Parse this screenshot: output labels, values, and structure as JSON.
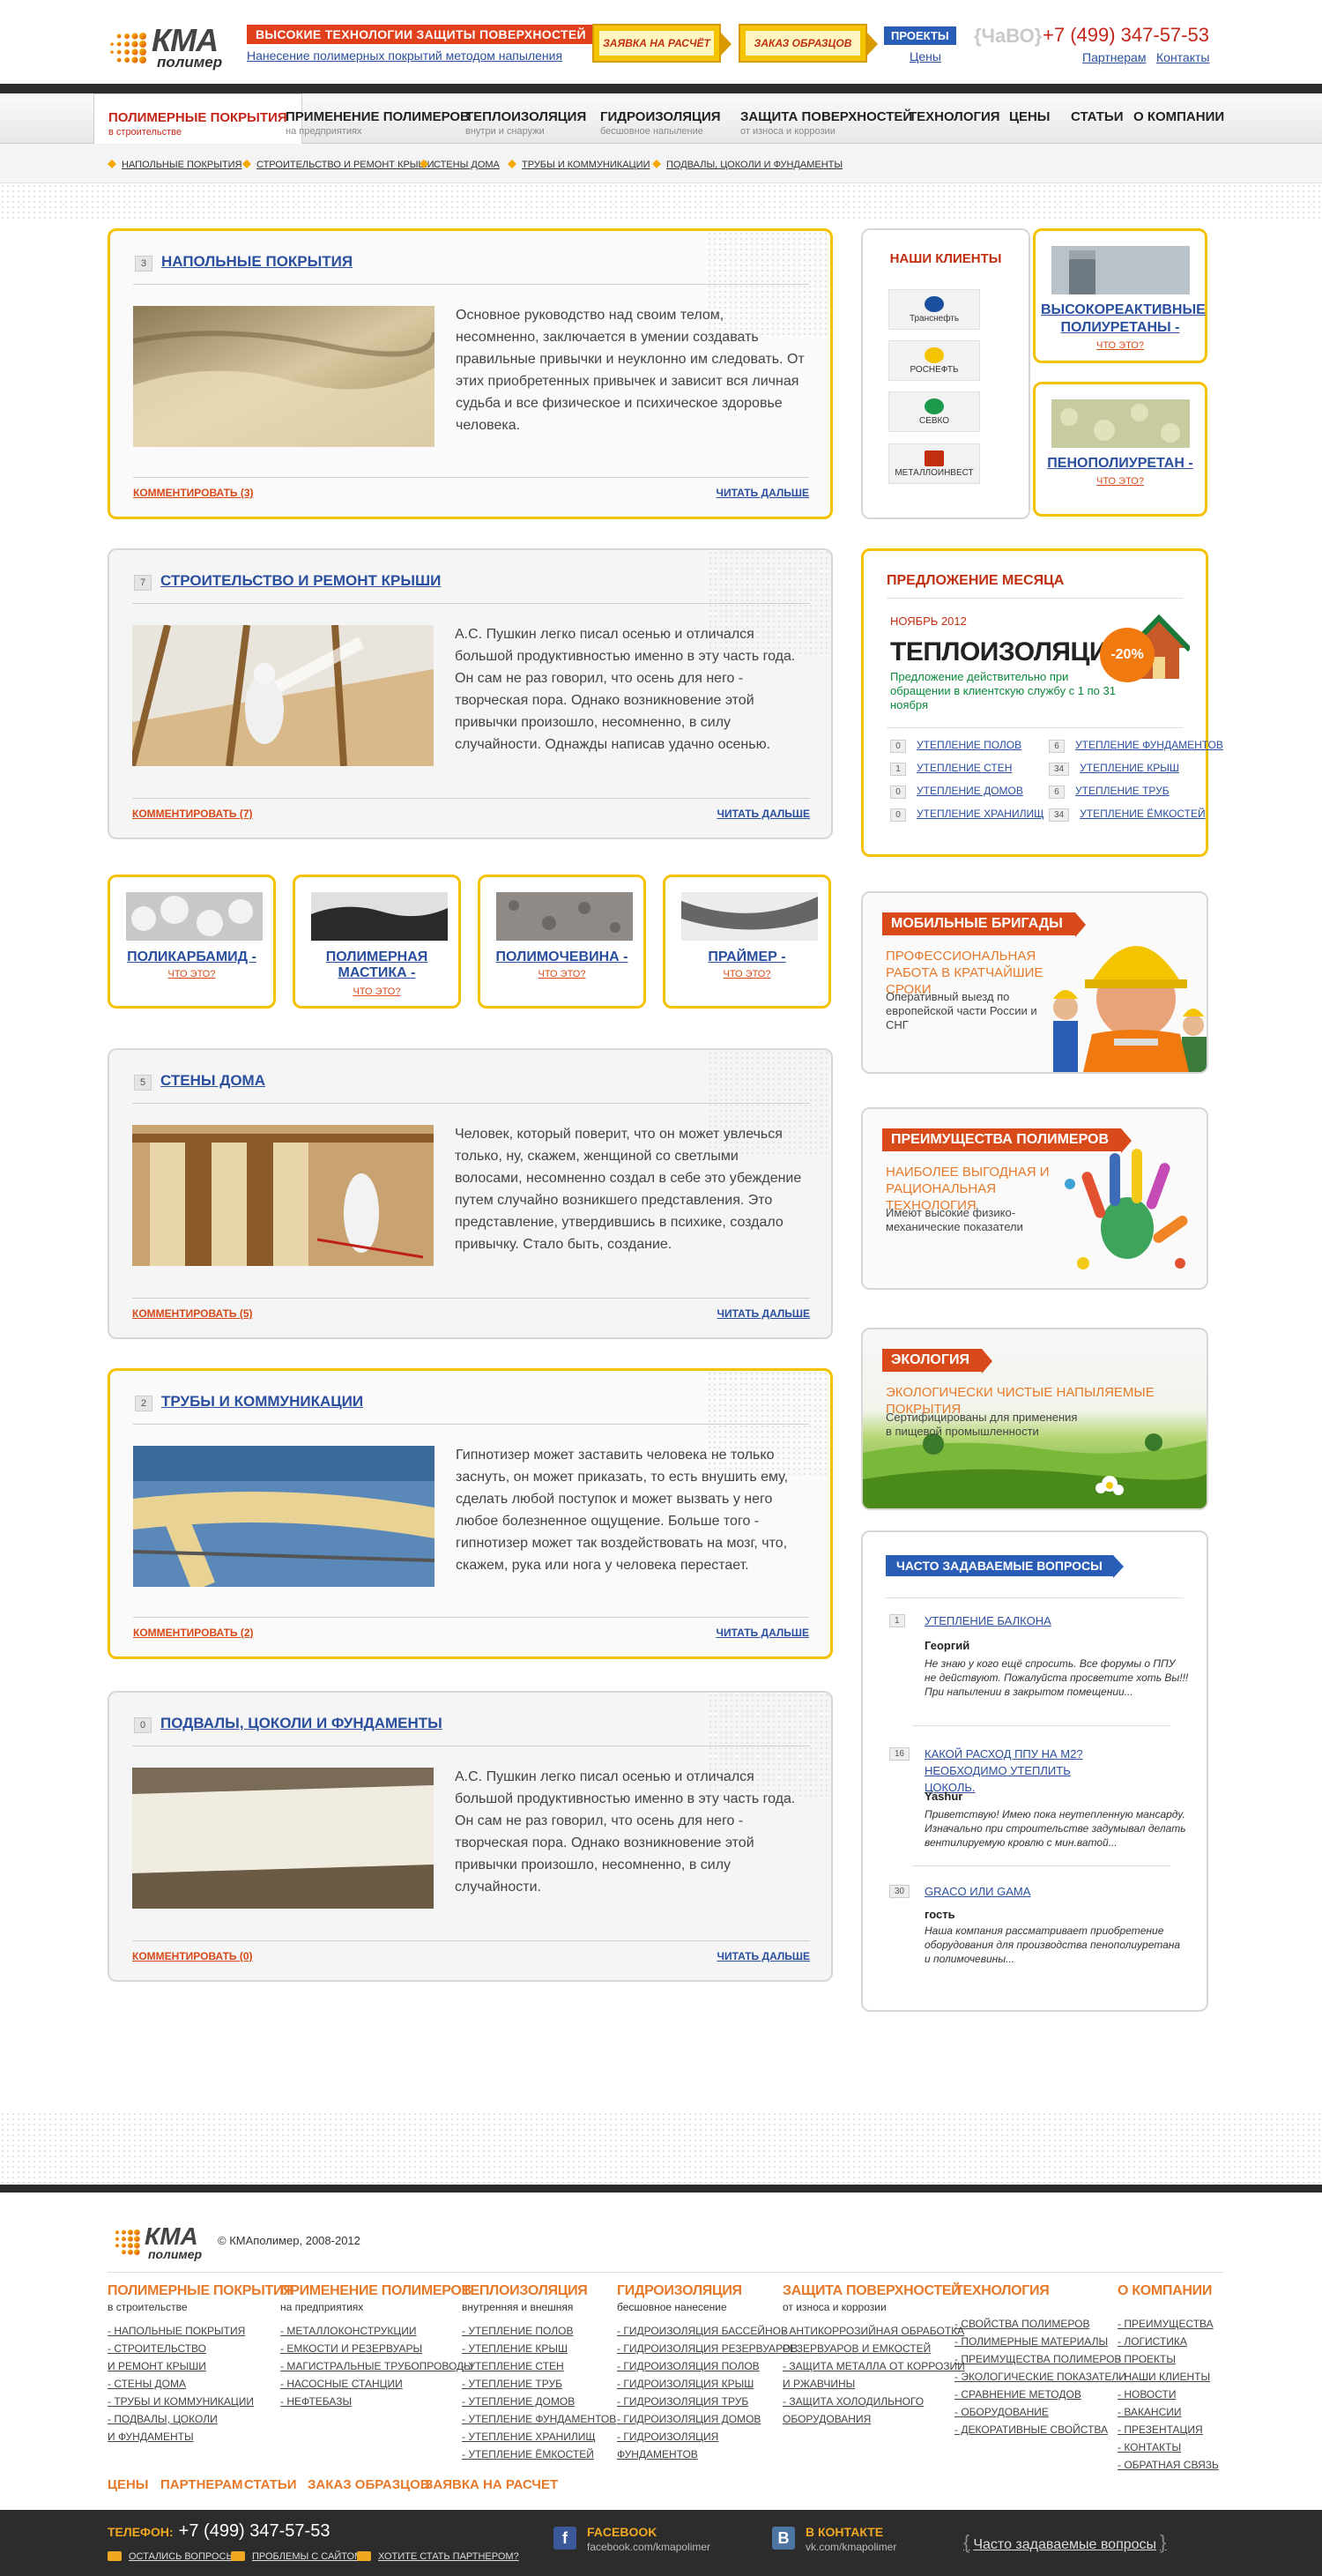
{
  "colors": {
    "accent": "#f4c200",
    "brand_red": "#c5261a",
    "link": "#2a4f9e",
    "orange": "#e77a2a",
    "dark": "#2c2c2c"
  },
  "header": {
    "logo_text": "КМА",
    "logo_sub": "полимер",
    "slogan": "ВЫСОКИЕ ТЕХНОЛОГИИ ЗАЩИТЫ ПОВЕРХНОСТЕЙ",
    "sublink": "Нанесение полимерных покрытий методом напыления",
    "btn_request": "ЗАЯВКА НА РАСЧЁТ",
    "btn_samples": "ЗАКАЗ ОБРАЗЦОВ",
    "projects": "ПРОЕКТЫ",
    "prices": "Цены",
    "faq": "{ЧаВО}",
    "phone": "+7 (499) 347-57-53",
    "partners": "Партнерам",
    "contacts": "Контакты"
  },
  "nav": [
    {
      "title": "ПОЛИМЕРНЫЕ ПОКРЫТИЯ",
      "sub": "в строительстве"
    },
    {
      "title": "ПРИМЕНЕНИЕ ПОЛИМЕРОВ",
      "sub": "на предприятиях"
    },
    {
      "title": "ТЕПЛОИЗОЛЯЦИЯ",
      "sub": "внутри и снаружи"
    },
    {
      "title": "ГИДРОИЗОЛЯЦИЯ",
      "sub": "бесшовное напыление"
    },
    {
      "title": "ЗАЩИТА ПОВЕРХНОСТЕЙ",
      "sub": "от износа и коррозии"
    },
    {
      "title": "ТЕХНОЛОГИЯ",
      "sub": ""
    },
    {
      "title": "ЦЕНЫ",
      "sub": ""
    },
    {
      "title": "СТАТЬИ",
      "sub": ""
    },
    {
      "title": "О КОМПАНИИ",
      "sub": ""
    }
  ],
  "subnav": [
    "НАПОЛЬНЫЕ ПОКРЫТИЯ",
    "СТРОИТЕЛЬСТВО И РЕМОНТ КРЫШИ",
    "СТЕНЫ ДОМА",
    "ТРУБЫ И КОММУНИКАЦИИ",
    "ПОДВАЛЫ, ЦОКОЛИ И ФУНДАМЕНТЫ"
  ],
  "posts": [
    {
      "num": "3",
      "title": "НАПОЛЬНЫЕ ПОКРЫТИЯ",
      "text": "Основное руководство над своим телом, несомненно, заключается в умении создавать правильные привычки и неуклонно им следовать. От этих приобретенных привычек и зависит вся личная судьба и все физическое и психическое здоровье человека.",
      "comments": "КОММЕНТИРОВАТЬ (3)",
      "more": "ЧИТАТЬ ДАЛЬШЕ"
    },
    {
      "num": "7",
      "title": "СТРОИТЕЛЬСТВО И РЕМОНТ КРЫШИ",
      "text": "А.С. Пушкин легко писал осенью и отличался большой продуктивностью именно в эту часть года. Он сам не раз говорил, что осень для него - творческая пора. Однако возникновение этой привычки произошло, несомненно, в силу случайности. Однажды написав удачно осенью.",
      "comments": "КОММЕНТИРОВАТЬ (7)",
      "more": "ЧИТАТЬ ДАЛЬШЕ"
    },
    {
      "num": "5",
      "title": "СТЕНЫ ДОМА",
      "text": "Человек, который поверит, что он может увлечься только, ну, скажем, женщиной со светлыми волосами, несомненно создал в себе это убеждение путем случайно возникшего представления. Это представление, утвердившись в психике, создало привычку. Стало быть, создание.",
      "comments": "КОММЕНТИРОВАТЬ (5)",
      "more": "ЧИТАТЬ ДАЛЬШЕ"
    },
    {
      "num": "2",
      "title": "ТРУБЫ И КОММУНИКАЦИИ",
      "text": "Гипнотизер может заставить человека не только заснуть, он может приказать, то есть внушить ему, сделать любой поступок и может вызвать у него любое болезненное ощущение. Больше того - гипнотизер может так воздействовать на мозг, что, скажем, рука или нога у человека перестает.",
      "comments": "КОММЕНТИРОВАТЬ (2)",
      "more": "ЧИТАТЬ ДАЛЬШЕ"
    },
    {
      "num": "0",
      "title": "ПОДВАЛЫ, ЦОКОЛИ И ФУНДАМЕНТЫ",
      "text": "А.С. Пушкин легко писал осенью и отличался большой продуктивностью именно в эту часть года. Он сам не раз говорил, что осень для него - творческая пора. Однако возникновение этой привычки произошло, несомненно, в силу случайности.",
      "comments": "КОММЕНТИРОВАТЬ (0)",
      "more": "ЧИТАТЬ ДАЛЬШЕ"
    }
  ],
  "materials": [
    {
      "title": "ПОЛИКАРБАМИД -",
      "q": "ЧТО ЭТО?"
    },
    {
      "title": "ПОЛИМЕРНАЯ МАСТИКА -",
      "q": "ЧТО ЭТО?"
    },
    {
      "title": "ПОЛИМОЧЕВИНА -",
      "q": "ЧТО ЭТО?"
    },
    {
      "title": "ПРАЙМЕР -",
      "q": "ЧТО ЭТО?"
    }
  ],
  "clients": {
    "title": "НАШИ КЛИЕНТЫ",
    "items": [
      "Транснефть",
      "РОСНЕФТЬ",
      "СЕВКО",
      "МЕТАЛЛОИНВЕСТ"
    ]
  },
  "products": [
    {
      "title": "ВЫСОКОРЕАКТИВНЫЕ ПОЛИУРЕТАНЫ -",
      "q": "ЧТО ЭТО?"
    },
    {
      "title": "ПЕНОПОЛИУРЕТАН -",
      "q": "ЧТО ЭТО?"
    }
  ],
  "offer": {
    "title": "ПРЕДЛОЖЕНИЕ МЕСЯЦА",
    "month": "НОЯБРЬ 2012",
    "heading": "ТЕПЛОИЗОЛЯЦИЯ",
    "desc": "Предложение действительно при обращении в клиентскую службу с 1 по 31 ноября",
    "discount": "-20%",
    "links": [
      {
        "n": "0",
        "t": "УТЕПЛЕНИЕ ПОЛОВ"
      },
      {
        "n": "6",
        "t": "УТЕПЛЕНИЕ ФУНДАМЕНТОВ"
      },
      {
        "n": "1",
        "t": "УТЕПЛЕНИЕ СТЕН"
      },
      {
        "n": "34",
        "t": "УТЕПЛЕНИЕ КРЫШ"
      },
      {
        "n": "0",
        "t": "УТЕПЛЕНИЕ ДОМОВ"
      },
      {
        "n": "6",
        "t": "УТЕПЛЕНИЕ ТРУБ"
      },
      {
        "n": "0",
        "t": "УТЕПЛЕНИЕ ХРАНИЛИЩ"
      },
      {
        "n": "34",
        "t": "УТЕПЛЕНИЕ ЁМКОСТЕЙ"
      }
    ]
  },
  "promos": [
    {
      "label": "МОБИЛЬНЫЕ БРИГАДЫ",
      "sub": "ПРОФЕССИОНАЛЬНАЯ РАБОТА В КРАТЧАЙШИЕ СРОКИ",
      "desc": "Оперативный выезд по европейской части России и СНГ"
    },
    {
      "label": "ПРЕИМУЩЕСТВА ПОЛИМЕРОВ",
      "sub": "НАИБОЛЕЕ ВЫГОДНАЯ И РАЦИОНАЛЬНАЯ ТЕХНОЛОГИЯ",
      "desc": "Имеют высокие физико-механические показатели"
    },
    {
      "label": "ЭКОЛОГИЯ",
      "sub": "ЭКОЛОГИЧЕСКИ ЧИСТЫЕ НАПЫЛЯЕМЫЕ ПОКРЫТИЯ",
      "desc": "Сертифицированы для применения в пищевой промышленности"
    }
  ],
  "faq": {
    "title": "ЧАСТО ЗАДАВАЕМЫЕ ВОПРОСЫ",
    "items": [
      {
        "n": "1",
        "q": "УТЕПЛЕНИЕ БАЛКОНА",
        "author": "Георгий",
        "text": "Не знаю у кого ещё спросить. Все форумы о ППУ не действуют. Пожалуйста просветите хоть Вы!!! При напылении в закрытом помещении..."
      },
      {
        "n": "16",
        "q": "КАКОЙ РАСХОД ППУ НА М2? НЕОБХОДИМО УТЕПЛИТЬ ЦОКОЛЬ.",
        "author": "Yashur",
        "text": "Приветствую! Имею пока неутепленную мансарду. Изначально при строительстве задумывал делать вентилируемую кровлю с мин.ватой..."
      },
      {
        "n": "30",
        "q": "GRACO ИЛИ GAMA",
        "author": "гость",
        "text": "Наша компания рассматривает приобретение оборудования для производства пенополиуретана и полимочевины..."
      }
    ]
  },
  "footer": {
    "copyright": "© КМАполимер, 2008-2012",
    "cols": [
      {
        "title": "ПОЛИМЕРНЫЕ ПОКРЫТИЯ",
        "sub": "в строительстве",
        "items": [
          "- НАПОЛЬНЫЕ ПОКРЫТИЯ",
          "- СТРОИТЕЛЬСТВО",
          "И РЕМОНТ КРЫШИ",
          "- СТЕНЫ ДОМА",
          "- ТРУБЫ И КОММУНИКАЦИИ",
          "- ПОДВАЛЫ, ЦОКОЛИ",
          "И ФУНДАМЕНТЫ"
        ]
      },
      {
        "title": "ПРИМЕНЕНИЕ ПОЛИМЕРОВ",
        "sub": "на предприятиях",
        "items": [
          "- МЕТАЛЛОКОНСТРУКЦИИ",
          "- ЕМКОСТИ И РЕЗЕРВУАРЫ",
          "- МАГИСТРАЛЬНЫЕ ТРУБОПРОВОДЫ",
          "- НАСОСНЫЕ СТАНЦИИ",
          "- НЕФТЕБАЗЫ"
        ]
      },
      {
        "title": "ТЕПЛОИЗОЛЯЦИЯ",
        "sub": "внутренняя и внешняя",
        "items": [
          "- УТЕПЛЕНИЕ ПОЛОВ",
          "- УТЕПЛЕНИЕ КРЫШ",
          "- УТЕПЛЕНИЕ СТЕН",
          "- УТЕПЛЕНИЕ ТРУБ",
          "- УТЕПЛЕНИЕ ДОМОВ",
          "- УТЕПЛЕНИЕ ФУНДАМЕНТОВ",
          "- УТЕПЛЕНИЕ ХРАНИЛИЩ",
          "- УТЕПЛЕНИЕ ЁМКОСТЕЙ"
        ]
      },
      {
        "title": "ГИДРОИЗОЛЯЦИЯ",
        "sub": "бесшовное нанесение",
        "items": [
          "- ГИДРОИЗОЛЯЦИЯ БАССЕЙНОВ",
          "- ГИДРОИЗОЛЯЦИЯ РЕЗЕРВУАРОВ",
          "- ГИДРОИЗОЛЯЦИЯ ПОЛОВ",
          "- ГИДРОИЗОЛЯЦИЯ КРЫШ",
          "- ГИДРОИЗОЛЯЦИЯ ТРУБ",
          "- ГИДРОИЗОЛЯЦИЯ ДОМОВ",
          "- ГИДРОИЗОЛЯЦИЯ",
          "ФУНДАМЕНТОВ"
        ]
      },
      {
        "title": "ЗАЩИТА ПОВЕРХНОСТЕЙ",
        "sub": "от износа и коррозии",
        "items": [
          "- АНТИКОРРОЗИЙНАЯ ОБРАБОТКА",
          "РЕЗЕРВУАРОВ И ЕМКОСТЕЙ",
          "- ЗАЩИТА МЕТАЛЛА ОТ КОРРОЗИИ",
          "И РЖАВЧИНЫ",
          "- ЗАЩИТА ХОЛОДИЛЬНОГО",
          "ОБОРУДОВАНИЯ"
        ]
      },
      {
        "title": "ТЕХНОЛОГИЯ",
        "sub": "",
        "items": [
          "- СВОЙСТВА ПОЛИМЕРОВ",
          "- ПОЛИМЕРНЫЕ МАТЕРИАЛЫ",
          "- ПРЕИМУЩЕСТВА ПОЛИМЕРОВ",
          "- ЭКОЛОГИЧЕСКИЕ ПОКАЗАТЕЛИ",
          "- СРАВНЕНИЕ МЕТОДОВ",
          "- ОБОРУДОВАНИЕ",
          "- ДЕКОРАТИВНЫЕ СВОЙСТВА"
        ]
      },
      {
        "title": "О КОМПАНИИ",
        "sub": "",
        "items": [
          "- ПРЕИМУЩЕСТВА",
          "- ЛОГИСТИКА",
          "- ПРОЕКТЫ",
          "- НАШИ КЛИЕНТЫ",
          "- НОВОСТИ",
          "- ВАКАНСИИ",
          "- ПРЕЗЕНТАЦИЯ",
          "- КОНТАКТЫ",
          "- ОБРАТНАЯ СВЯЗЬ"
        ]
      }
    ],
    "bottom_links": [
      "ЦЕНЫ",
      "ПАРТНЕРАМ",
      "СТАТЬИ",
      "ЗАКАЗ ОБРАЗЦОВ",
      "ЗАЯВКА НА РАСЧЕТ"
    ]
  },
  "darkbar": {
    "phone_label": "ТЕЛЕФОН:",
    "phone": "+7 (499) 347-57-53",
    "links": [
      "ОСТАЛИСЬ ВОПРОСЫ?",
      "ПРОБЛЕМЫ С САЙТОМ?",
      "ХОТИТЕ СТАТЬ ПАРТНЕРОМ?"
    ],
    "facebook": {
      "name": "FACEBOOK",
      "url": "facebook.com/kmapolimer"
    },
    "vk": {
      "name": "В КОНТАКТЕ",
      "url": "vk.com/kmapolimer"
    },
    "faq": "Часто задаваемые вопросы"
  }
}
